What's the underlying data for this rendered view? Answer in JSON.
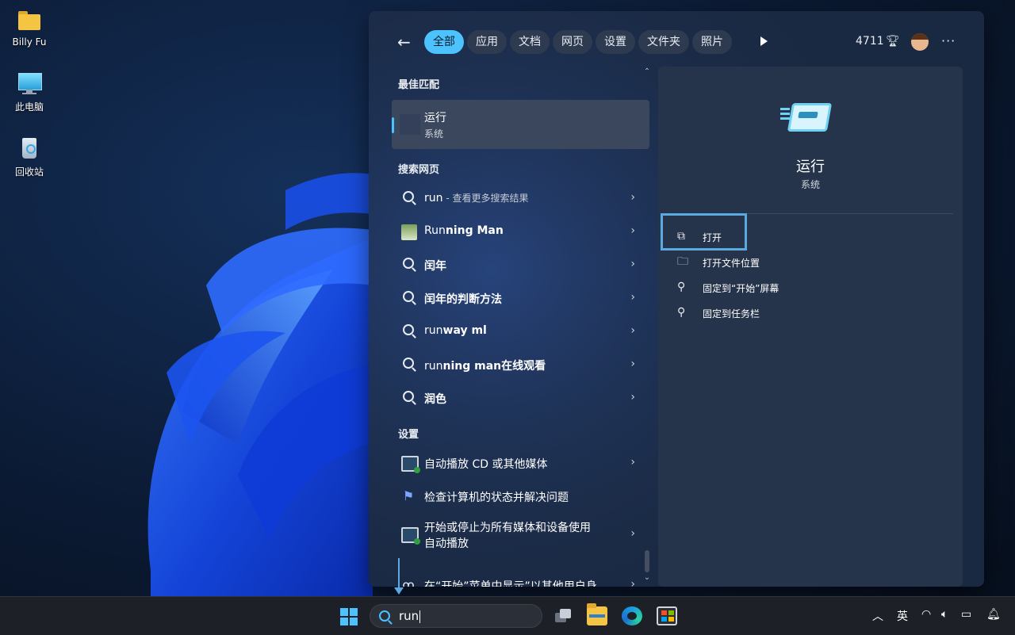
{
  "desktop": {
    "icons": [
      {
        "label": "Billy Fu",
        "icon": "folder-icon"
      },
      {
        "label": "此电脑",
        "icon": "computer-icon"
      },
      {
        "label": "回收站",
        "icon": "recycle-bin-icon"
      }
    ]
  },
  "search_panel": {
    "tabs": [
      {
        "label": "全部",
        "active": true
      },
      {
        "label": "应用"
      },
      {
        "label": "文档"
      },
      {
        "label": "网页"
      },
      {
        "label": "设置"
      },
      {
        "label": "文件夹"
      },
      {
        "label": "照片"
      }
    ],
    "points": "4711",
    "sections": {
      "best_match": "最佳匹配",
      "web_search": "搜索网页",
      "settings": "设置"
    },
    "best_match": {
      "title": "运行",
      "subtitle": "系统"
    },
    "web_results": [
      {
        "bold": "run",
        "dim": " - 查看更多搜索结果",
        "icon": "search-icon"
      },
      {
        "pre": "Run",
        "bold": "ning Man",
        "icon": "image-thumbnail-icon"
      },
      {
        "bold": "闰年",
        "icon": "search-icon"
      },
      {
        "bold": "闰年的判断方法",
        "icon": "search-icon"
      },
      {
        "pre": "run",
        "bold": "way ml",
        "icon": "search-icon"
      },
      {
        "pre": "run",
        "bold": "ning man在线观看",
        "icon": "search-icon"
      },
      {
        "bold": "润色",
        "icon": "search-icon"
      }
    ],
    "setting_results": [
      {
        "label": "自动播放 CD 或其他媒体",
        "icon": "autoplay-icon",
        "chevron": true
      },
      {
        "label": "检查计算机的状态并解决问题",
        "icon": "flag-icon",
        "chevron": false
      },
      {
        "label": "开始或停止为所有媒体和设备使用",
        "label2": "自动播放",
        "icon": "autoplay-icon",
        "chevron": true
      },
      {
        "label": "在“开始”菜单中显示”以其他用户身",
        "icon": "user-icon",
        "chevron": true
      }
    ],
    "details": {
      "title": "运行",
      "subtitle": "系统",
      "actions": [
        {
          "label": "打开",
          "icon": "open-external-icon"
        },
        {
          "label": "打开文件位置",
          "icon": "folder-open-icon"
        },
        {
          "label": "固定到“开始”屏幕",
          "icon": "pin-icon"
        },
        {
          "label": "固定到任务栏",
          "icon": "pin-icon"
        }
      ]
    }
  },
  "taskbar": {
    "search_text": "run",
    "ime_label": "英",
    "colors": {
      "accent": "#4cc2ff",
      "taskbar": "#1d2127"
    }
  }
}
